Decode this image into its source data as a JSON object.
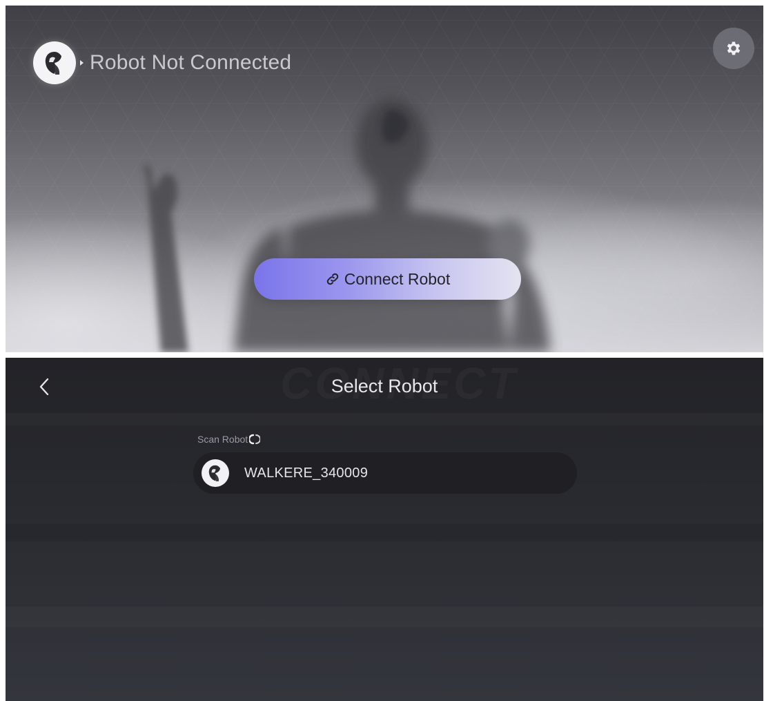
{
  "home": {
    "status_text": "Robot Not Connected",
    "connect_button_label": "Connect Robot",
    "icons": {
      "avatar": "robot-avatar-icon",
      "caret": "caret-right-icon",
      "settings": "gear-icon",
      "connect": "link-icon"
    }
  },
  "select": {
    "title": "Select Robot",
    "watermark": "CONNECT",
    "scan_label": "Scan Robot",
    "robots": [
      {
        "name": "WALKERE_340009"
      }
    ],
    "icons": {
      "back": "chevron-left-icon",
      "scanning": "spinner-icon",
      "robot": "robot-avatar-icon"
    }
  },
  "colors": {
    "accent_start": "#7a74ea",
    "accent_end": "#e4e3f0",
    "dark_bg": "#27282d",
    "item_bg": "#1f1f24"
  }
}
